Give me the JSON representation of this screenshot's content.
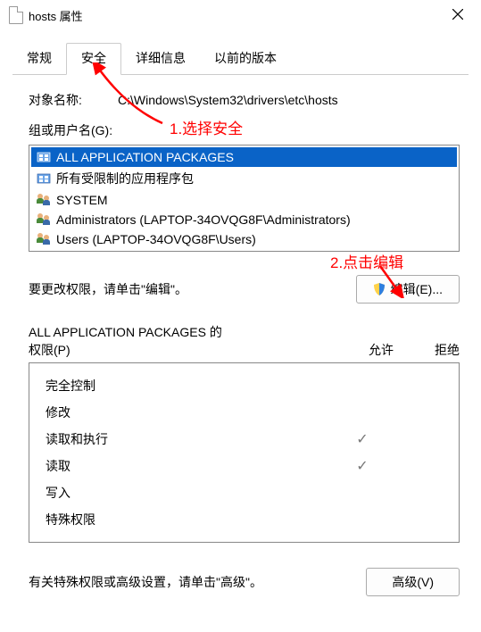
{
  "window": {
    "title": "hosts 属性"
  },
  "tabs": {
    "t0": "常规",
    "t1": "安全",
    "t2": "详细信息",
    "t3": "以前的版本"
  },
  "object": {
    "label": "对象名称:",
    "path": "C:\\Windows\\System32\\drivers\\etc\\hosts"
  },
  "annotations": {
    "step1": "1.选择安全",
    "step2": "2.点击编辑"
  },
  "groups": {
    "label": "组或用户名(G):",
    "items": {
      "0": {
        "name": "ALL APPLICATION PACKAGES"
      },
      "1": {
        "name": "所有受限制的应用程序包"
      },
      "2": {
        "name": "SYSTEM"
      },
      "3": {
        "name": "Administrators (LAPTOP-34OVQG8F\\Administrators)"
      },
      "4": {
        "name": "Users (LAPTOP-34OVQG8F\\Users)"
      }
    }
  },
  "edit": {
    "hint": "要更改权限，请单击\"编辑\"。",
    "button": "编辑(E)..."
  },
  "permissions": {
    "header_left": "ALL APPLICATION PACKAGES 的",
    "header_left2": "权限(P)",
    "allow": "允许",
    "deny": "拒绝",
    "rows": {
      "0": {
        "name": "完全控制",
        "allow": "",
        "deny": ""
      },
      "1": {
        "name": "修改",
        "allow": "",
        "deny": ""
      },
      "2": {
        "name": "读取和执行",
        "allow": "✓",
        "deny": ""
      },
      "3": {
        "name": "读取",
        "allow": "✓",
        "deny": ""
      },
      "4": {
        "name": "写入",
        "allow": "",
        "deny": ""
      },
      "5": {
        "name": "特殊权限",
        "allow": "",
        "deny": ""
      }
    }
  },
  "advanced": {
    "hint": "有关特殊权限或高级设置，请单击\"高级\"。",
    "button": "高级(V)"
  }
}
